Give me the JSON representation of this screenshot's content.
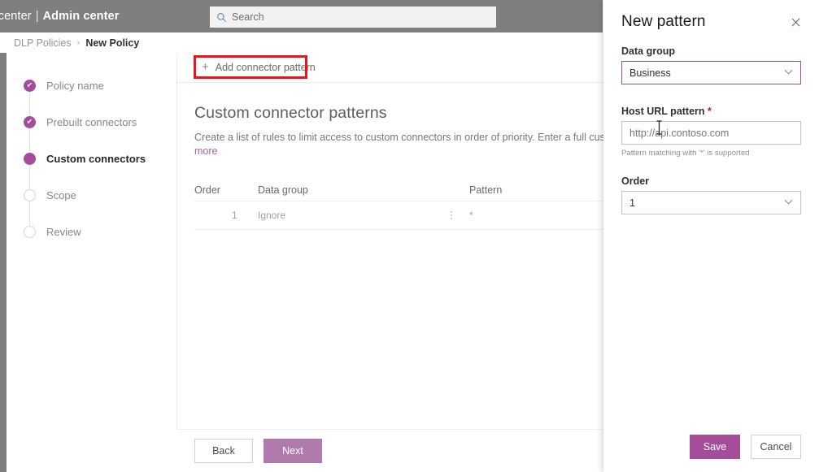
{
  "suite": {
    "title_truncated": "min center",
    "separator": "|",
    "title_main": "Admin center"
  },
  "search": {
    "placeholder": "Search",
    "icon": "search-icon"
  },
  "breadcrumb": {
    "parent": "DLP Policies",
    "separator": "›",
    "current": "New Policy"
  },
  "wizard": {
    "steps": [
      {
        "label": "Policy name",
        "state": "done"
      },
      {
        "label": "Prebuilt connectors",
        "state": "done"
      },
      {
        "label": "Custom connectors",
        "state": "current"
      },
      {
        "label": "Scope",
        "state": "todo"
      },
      {
        "label": "Review",
        "state": "todo"
      }
    ],
    "check_glyph": "✔"
  },
  "commandbar": {
    "add_pattern_label": "Add connector pattern",
    "plus_glyph": "+"
  },
  "section": {
    "title": "Custom connector patterns",
    "description": "Create a list of rules to limit access to custom connectors in order of priority. Enter a full custom connector U",
    "more_link": "more"
  },
  "table": {
    "columns": [
      "Order",
      "Data group",
      "Pattern"
    ],
    "rows": [
      {
        "order": "1",
        "data_group": "Ignore",
        "pattern": "*"
      }
    ],
    "row_menu_icon": "more-vertical-icon"
  },
  "footer": {
    "back_label": "Back",
    "next_label": "Next"
  },
  "panel": {
    "title": "New pattern",
    "close_icon": "close-icon",
    "data_group": {
      "label": "Data group",
      "value": "Business",
      "chevron": "∨"
    },
    "host_url": {
      "label": "Host URL pattern",
      "required_marker": "*",
      "placeholder": "http://api.contoso.com",
      "hint": "Pattern matching with '*' is supported"
    },
    "order": {
      "label": "Order",
      "value": "1",
      "chevron": "∨"
    },
    "save_label": "Save",
    "cancel_label": "Cancel"
  },
  "colors": {
    "brand_purple": "#a54d9b",
    "suite_gray": "#7f7f7f",
    "annotation_red": "#e8161a",
    "search_icon_blue": "#4a7ebb"
  }
}
